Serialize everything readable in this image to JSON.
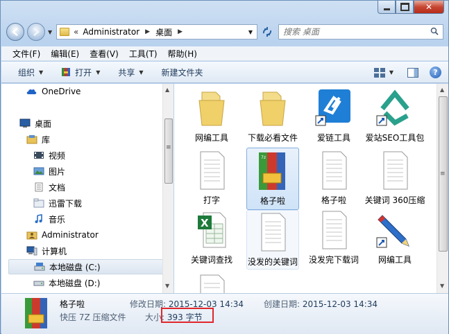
{
  "window": {
    "caption": {
      "minimize": "",
      "maximize": "",
      "close": "✕"
    }
  },
  "address": {
    "crumb_sep": "«",
    "crumbs": [
      "Administrator",
      "桌面"
    ],
    "search_placeholder": "搜索 桌面"
  },
  "menu": [
    "文件(F)",
    "编辑(E)",
    "查看(V)",
    "工具(T)",
    "帮助(H)"
  ],
  "toolbar": {
    "organize": "组织",
    "open": "打开",
    "share": "共享",
    "new_folder": "新建文件夹"
  },
  "navpane": {
    "items": [
      {
        "label": "OneDrive",
        "icon": "cloud-icon"
      },
      {
        "label": "桌面",
        "icon": "desktop-icon"
      },
      {
        "label": "库",
        "icon": "library-icon"
      },
      {
        "label": "视频",
        "icon": "video-icon"
      },
      {
        "label": "图片",
        "icon": "picture-icon"
      },
      {
        "label": "文档",
        "icon": "document-icon"
      },
      {
        "label": "迅雷下载",
        "icon": "folder-icon"
      },
      {
        "label": "音乐",
        "icon": "music-icon"
      },
      {
        "label": "Administrator",
        "icon": "user-folder-icon"
      },
      {
        "label": "计算机",
        "icon": "computer-icon"
      },
      {
        "label": "本地磁盘 (C:)",
        "icon": "drive-icon"
      },
      {
        "label": "本地磁盘 (D:)",
        "icon": "drive-icon"
      }
    ]
  },
  "files": [
    {
      "label": "网编工具",
      "icon": "folder-icon"
    },
    {
      "label": "下载必看文件",
      "icon": "folder-icon"
    },
    {
      "label": "爱链工具",
      "icon": "shortcut-link-icon"
    },
    {
      "label": "爱站SEO工具包",
      "icon": "shortcut-seo-icon"
    },
    {
      "label": "打字",
      "icon": "text-file-icon"
    },
    {
      "label": "格子啦",
      "icon": "archive-icon"
    },
    {
      "label": "格子啦",
      "icon": "text-file-icon"
    },
    {
      "label": "关键词 360压缩",
      "icon": "text-file-icon"
    },
    {
      "label": "关键词查找",
      "icon": "excel-icon"
    },
    {
      "label": "没发的关键词",
      "icon": "text-file-icon"
    },
    {
      "label": "没发完下载词",
      "icon": "text-file-icon"
    },
    {
      "label": "网编工具",
      "icon": "shortcut-pencil-icon"
    },
    {
      "label": "",
      "icon": "text-file-icon"
    }
  ],
  "details": {
    "name": "格子啦",
    "type": "快压 7Z 压缩文件",
    "modified_label": "修改日期:",
    "modified_value": "2015-12-03 14:34",
    "created_label": "创建日期:",
    "created_value": "2015-12-03 14:34",
    "size_label": "大小:",
    "size_value": "393 字节"
  },
  "colors": {
    "accent": "#2c62a6",
    "selection": "#cfe3f8",
    "highlight_box": "#e0262c"
  }
}
